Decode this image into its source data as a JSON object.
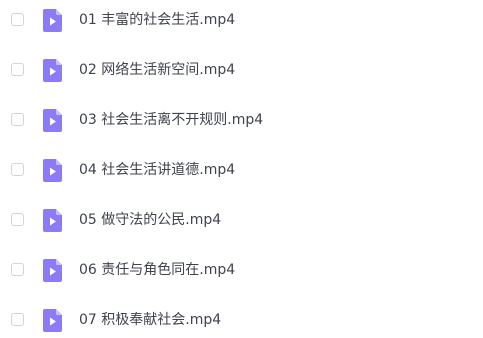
{
  "file_list": {
    "items": [
      {
        "name": "01 丰富的社会生活.mp4",
        "icon": "video-file-icon",
        "checked": false
      },
      {
        "name": "02 网络生活新空间.mp4",
        "icon": "video-file-icon",
        "checked": false
      },
      {
        "name": "03 社会生活离不开规则.mp4",
        "icon": "video-file-icon",
        "checked": false
      },
      {
        "name": "04 社会生活讲道德.mp4",
        "icon": "video-file-icon",
        "checked": false
      },
      {
        "name": "05 做守法的公民.mp4",
        "icon": "video-file-icon",
        "checked": false
      },
      {
        "name": "06 责任与角色同在.mp4",
        "icon": "video-file-icon",
        "checked": false
      },
      {
        "name": "07 积极奉献社会.mp4",
        "icon": "video-file-icon",
        "checked": false
      }
    ]
  },
  "colors": {
    "icon_fill": "#8b7cf6",
    "icon_fold": "#c7bffc",
    "text": "#3f434d",
    "checkbox_border": "#d3d3d8"
  }
}
